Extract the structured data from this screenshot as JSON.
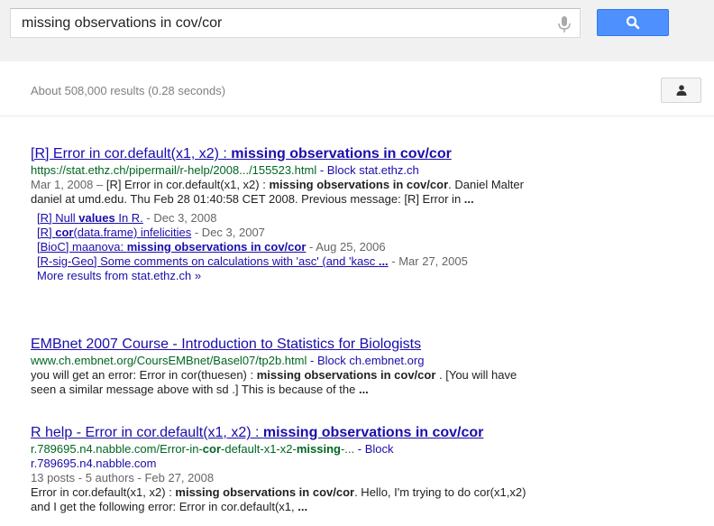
{
  "search": {
    "query": "missing observations in cov/cor"
  },
  "stats": "About 508,000 results (0.28 seconds)",
  "results": [
    {
      "title_a": "[R] Error in cor.default(x1, x2) : ",
      "title_b": "missing observations in cov/cor",
      "url": "https://stat.ethz.ch/pipermail/r-help/2008.../155523.html",
      "block": "- Block stat.ethz.ch",
      "snippet": {
        "date": "Mar 1, 2008 –",
        "p1": " [R] Error in cor.default(x1, x2) : ",
        "b1": "missing observations in cov/cor",
        "p2": ". Daniel Malter daniel at umd.edu. Thu Feb 28 01:40:58 CET 2008. Previous message: [R] Error in ",
        "b2": "..."
      },
      "sublinks": [
        {
          "parts": [
            {
              "t": "[R] Null ",
              "b": false
            },
            {
              "t": "values",
              "b": true
            },
            {
              "t": " In R.",
              "b": false
            }
          ],
          "date": " - Dec 3, 2008"
        },
        {
          "parts": [
            {
              "t": "[R] ",
              "b": false
            },
            {
              "t": "cor",
              "b": true
            },
            {
              "t": "(data.frame) infelicities",
              "b": false
            }
          ],
          "date": " - Dec 3, 2007"
        },
        {
          "parts": [
            {
              "t": "[BioC] maanova: ",
              "b": false
            },
            {
              "t": "missing observations in cov/cor",
              "b": true
            }
          ],
          "date": " - Aug 25, 2006"
        },
        {
          "parts": [
            {
              "t": "[R-sig-Geo] Some comments on calculations with 'asc' (and 'kasc ",
              "b": false
            },
            {
              "t": "...",
              "b": true
            }
          ],
          "date": " - Mar 27, 2005"
        }
      ],
      "more": "More results from stat.ethz.ch »"
    },
    {
      "title": "EMBnet 2007 Course - Introduction to Statistics for Biologists",
      "url": "www.ch.embnet.org/CoursEMBnet/Basel07/tp2b.html",
      "block": "- Block ch.embnet.org",
      "snippet": {
        "p1": "you will get an error: Error in cor(thuesen) : ",
        "b1": "missing observations in cov/cor",
        "p2": " . [You will have seen a similar message above with sd .] This is because of the ",
        "b2": "..."
      }
    },
    {
      "title_a": "R help - Error in cor.default(x1, x2) : ",
      "title_b": "missing observations in cov/cor",
      "url_parts": [
        {
          "t": "r.789695.n4.nabble.com/Error-in-",
          "b": false
        },
        {
          "t": "cor",
          "b": true
        },
        {
          "t": "-default-x1-x2-",
          "b": false
        },
        {
          "t": "missing",
          "b": true
        },
        {
          "t": "-...",
          "b": false
        }
      ],
      "block": "- Block",
      "block_domain": "r.789695.n4.nabble.com",
      "meta": "13 posts - 5 authors - Feb 27, 2008",
      "snippet": {
        "p1": "Error in cor.default(x1, x2) : ",
        "b1": "missing observations in cov/cor",
        "p2": ". Hello, I'm trying to do cor(x1,x2) and I get the following error: Error in cor.default(x1, ",
        "b2": "..."
      }
    }
  ],
  "colors": {
    "link": "#1a0dab",
    "url": "#006621",
    "accent": "#4d90fe"
  },
  "icons": {
    "mic": "microphone-icon",
    "search": "search-icon",
    "person": "person-icon"
  }
}
